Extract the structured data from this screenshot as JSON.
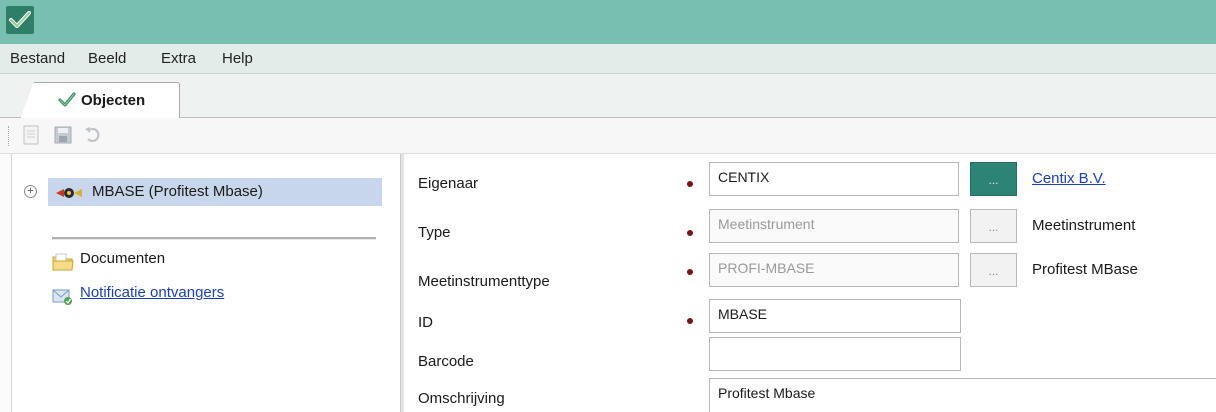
{
  "menu": [
    {
      "label": "Bestand"
    },
    {
      "label": "Beeld"
    },
    {
      "label": "Extra"
    },
    {
      "label": "Help"
    }
  ],
  "tab": {
    "label": "Objecten"
  },
  "tree": {
    "expander": "+",
    "node_label": "MBASE (Profitest Mbase)",
    "links": {
      "documents": "Documenten",
      "notifications": "Notificatie ontvangers"
    }
  },
  "form": {
    "owner": {
      "label": "Eigenaar",
      "value": "CENTIX",
      "button": "...",
      "display": "Centix B.V."
    },
    "type": {
      "label": "Type",
      "value": "Meetinstrument",
      "button": "...",
      "display": "Meetinstrument"
    },
    "instrument_type": {
      "label": "Meetinstrumenttype",
      "value": "PROFI-MBASE",
      "button": "...",
      "display": "Profitest MBase"
    },
    "id": {
      "label": "ID",
      "value": "MBASE"
    },
    "barcode": {
      "label": "Barcode",
      "value": ""
    },
    "description": {
      "label": "Omschrijving",
      "value": "Profitest Mbase"
    }
  },
  "colors": {
    "titlebar": "#78bfb0",
    "accent_button": "#2c8376",
    "selection": "#c8d6ec",
    "required_marker": "#7a1414",
    "link": "#1a3fb8"
  },
  "icons": [
    "app-logo-icon",
    "checkmark-icon",
    "new-document-icon",
    "save-icon",
    "undo-icon",
    "instrument-icon",
    "folder-icon",
    "notification-icon"
  ]
}
